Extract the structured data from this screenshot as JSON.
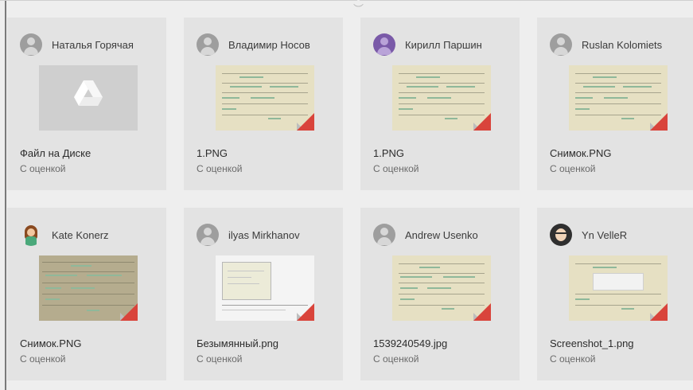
{
  "cards": [
    {
      "author": "Наталья Горячая",
      "avatar_icon": "default-avatar-icon",
      "title": "Файл на Диске",
      "status": "С оценкой",
      "thumb": "drive-icon"
    },
    {
      "author": "Владимир Носов",
      "avatar_icon": "default-avatar-icon",
      "title": "1.PNG",
      "status": "С оценкой",
      "thumb": "document-preview"
    },
    {
      "author": "Кирилл Паршин",
      "avatar_icon": "purple-avatar-icon",
      "title": "1.PNG",
      "status": "С оценкой",
      "thumb": "document-preview"
    },
    {
      "author": "Ruslan Kolomiets",
      "avatar_icon": "default-avatar-icon",
      "title": "Снимок.PNG",
      "status": "С оценкой",
      "thumb": "document-preview"
    },
    {
      "author": "Kate Konerz",
      "avatar_icon": "girl-avatar-icon",
      "title": "Снимок.PNG",
      "status": "С оценкой",
      "thumb": "document-preview"
    },
    {
      "author": "ilyas Mirkhanov",
      "avatar_icon": "default-avatar-icon",
      "title": "Безымянный.png",
      "status": "С оценкой",
      "thumb": "window-preview"
    },
    {
      "author": "Andrew Usenko",
      "avatar_icon": "default-avatar-icon",
      "title": "1539240549.jpg",
      "status": "С оценкой",
      "thumb": "document-preview"
    },
    {
      "author": "Yn VelleR",
      "avatar_icon": "dark-avatar-icon",
      "title": "Screenshot_1.png",
      "status": "С оценкой",
      "thumb": "dialog-preview"
    }
  ],
  "colors": {
    "card_bg": "#e3e3e3",
    "thumb_bg": "#e6e0c3",
    "line_green": "#8fb89a",
    "corner_red": "#d9443b",
    "text_primary": "#2c2c2c",
    "text_secondary": "#6a6a6a"
  }
}
